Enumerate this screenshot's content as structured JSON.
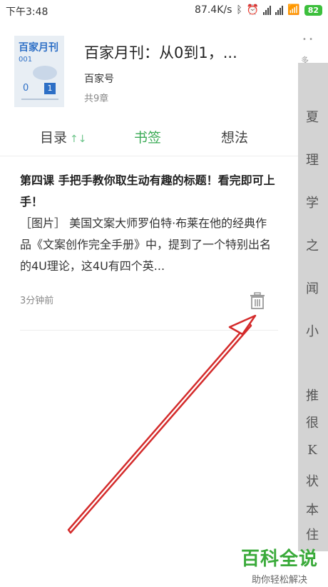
{
  "status_bar": {
    "time": "下午3:48",
    "speed": "87.4K/s",
    "battery": "82"
  },
  "background_page": {
    "top_dots": "• •",
    "more_label": "多",
    "glyphs": [
      "夏",
      "理",
      "学",
      "之",
      "闻",
      "小",
      "推",
      "很",
      "K",
      "状",
      "本",
      "住"
    ]
  },
  "book": {
    "cover": {
      "title": "百家月刊",
      "issue": "001",
      "zero": "0",
      "one": "1"
    },
    "title": "百家月刊：从0到1，...",
    "author": "百家号",
    "chapters": "共9章"
  },
  "tabs": [
    {
      "label": "目录",
      "sort_icon_text": "↑↓"
    },
    {
      "label": "书签"
    },
    {
      "label": "想法"
    }
  ],
  "bookmark": {
    "title": "第四课 手把手教你取生动有趣的标题！看完即可上手！",
    "excerpt": "［图片］ 美国文案大师罗伯特·布莱在他的经典作品《文案创作完全手册》中，提到了一个特别出名的4U理论，这4U有四个英...",
    "time": "3分钟前"
  },
  "watermark": {
    "main": "百科全说",
    "sub": "助你轻松解决"
  },
  "colors": {
    "accent_green": "#3aaa55",
    "annotation_red": "#d42b2b",
    "cover_blue": "#2d6fc6"
  }
}
